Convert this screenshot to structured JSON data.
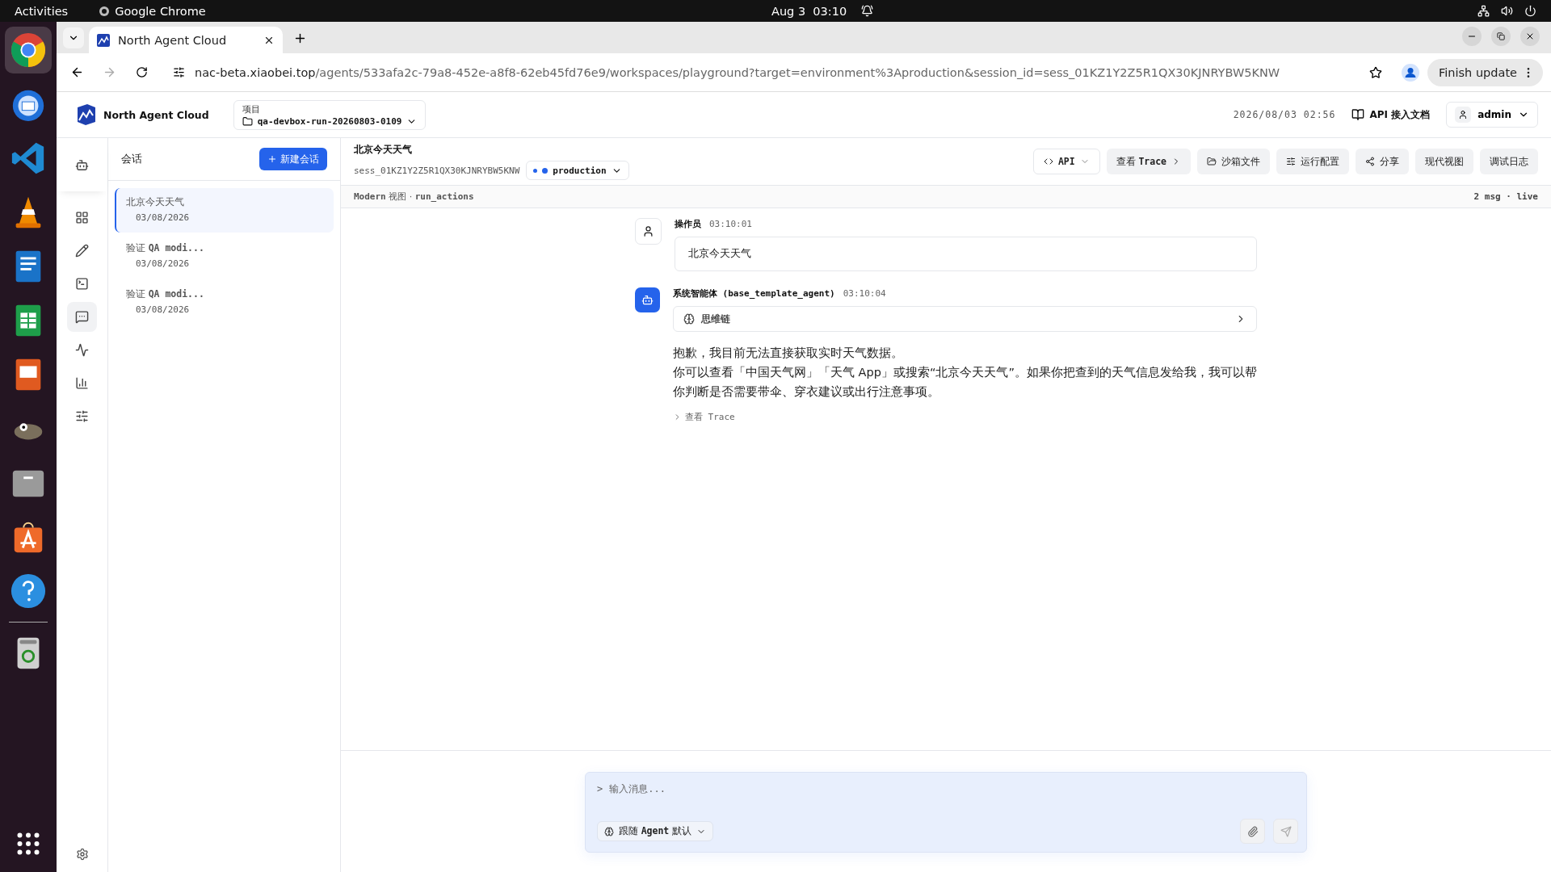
{
  "system_bar": {
    "activities": "Activities",
    "app": "Google Chrome",
    "clock": "Aug 3  03:10"
  },
  "browser": {
    "tab_title": "North Agent Cloud",
    "url_host": "nac-beta.xiaobei.top",
    "url_path": "/agents/533afa2c-79a8-452e-a8f8-62eb45fd76e9/workspaces/playground?target=environment%3Aproduction&session_id=sess_01KZ1Y2Z5R1QX30KJNRYBW5KNW",
    "update_button": "Finish update"
  },
  "header": {
    "brand": "North Agent Cloud",
    "project_label": "项目",
    "project": "qa-devbox-run-20260803-0109",
    "datetime": "2026/08/03 02:56",
    "docs_link": "API 接入文档",
    "user": "admin"
  },
  "nav": [
    {
      "kind": "agent",
      "selected": false
    },
    {
      "kind": "dashboard",
      "selected": false
    },
    {
      "kind": "edit",
      "selected": false
    },
    {
      "kind": "terminal",
      "selected": false
    },
    {
      "kind": "chat",
      "selected": true
    },
    {
      "kind": "activity",
      "selected": false
    },
    {
      "kind": "chart",
      "selected": false
    },
    {
      "kind": "sliders",
      "selected": false
    }
  ],
  "conversations": {
    "title": "会话",
    "new_button": "新建会话",
    "items": [
      {
        "title": "北京今天天气",
        "date": "03/08/2026",
        "selected": true
      },
      {
        "title": "验证 **QA modi...**",
        "date": "03/08/2026",
        "selected": false
      },
      {
        "title": "验证 **QA modi...**",
        "date": "03/08/2026",
        "selected": false
      }
    ]
  },
  "session": {
    "title": "北京今天天气",
    "id": "sess_01KZ1Y2Z5R1QX30KJNRYBW5KNW",
    "environment": "production",
    "actions": [
      {
        "label": "API",
        "kind": "dropdown"
      },
      {
        "label": "查看 **Trace**",
        "kind": "forward"
      },
      {
        "label": "沙箱文件",
        "kind": "plain"
      },
      {
        "label": "运行配置",
        "kind": "plain"
      },
      {
        "label": "分享",
        "kind": "plain"
      },
      {
        "label": "现代视图",
        "kind": "plain"
      },
      {
        "label": "调试日志",
        "kind": "plain"
      }
    ],
    "view_info": "**Modern** 视图 · **run_actions**",
    "status": "2 msg · live"
  },
  "messages": [
    {
      "kind": "user",
      "author": "操作员",
      "time": "03:10:01",
      "text": "北京今天天气"
    },
    {
      "kind": "agent",
      "author": "系统智能体 (base_template_agent)",
      "time": "03:10:04",
      "thinking": "思维链",
      "paragraphs": [
        "抱歉，我目前无法直接获取实时天气数据。",
        "你可以查看「中国天气网」「天气 App」或搜索“北京今天天气”。如果你把查到的天气信息发给我，我可以帮你判断是否需要带伞、穿衣建议或出行注意事项。"
      ],
      "trace_link": "查看 Trace"
    }
  ],
  "composer": {
    "prompt": ">",
    "placeholder": "输入消息...",
    "mode": "跟随 **Agent** 默认"
  }
}
